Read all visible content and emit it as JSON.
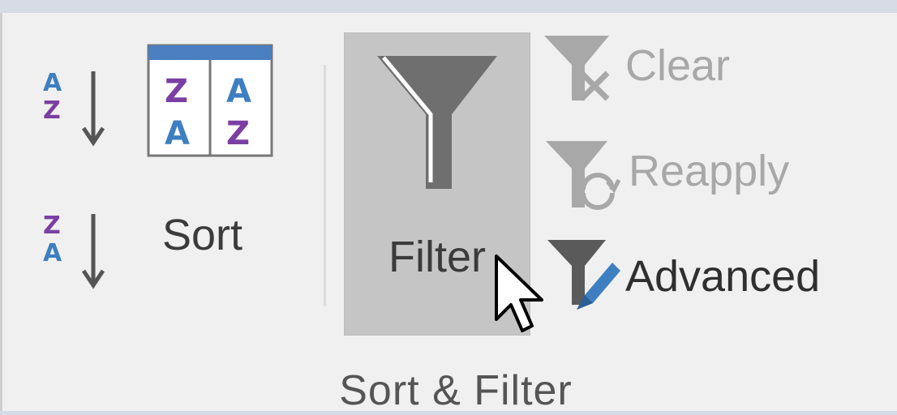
{
  "ribbon": {
    "sort_label": "Sort",
    "filter_label": "Filter",
    "clear_label": "Clear",
    "reapply_label": "Reapply",
    "advanced_label": "Advanced",
    "group_label": "Sort & Filter",
    "sort_az": {
      "top": "A",
      "bottom": "Z"
    },
    "sort_za": {
      "top": "Z",
      "bottom": "A"
    },
    "sort_dialog": {
      "col1_top": "Z",
      "col1_bottom": "A",
      "col2_top": "A",
      "col2_bottom": "Z"
    }
  },
  "colors": {
    "purple": "#7b3fa3",
    "blue": "#3e7fc1",
    "header_blue": "#4a7fc1",
    "funnel_gray": "#6f6f6f",
    "disabled_gray": "#a8a8a8",
    "highlight": "#c5c5c5"
  },
  "icons": {
    "sort_az": "sort-ascending-icon",
    "sort_za": "sort-descending-icon",
    "sort": "sort-dialog-icon",
    "filter": "funnel-icon",
    "clear": "clear-filter-icon",
    "reapply": "reapply-filter-icon",
    "advanced": "advanced-filter-icon",
    "cursor": "mouse-pointer-icon"
  }
}
